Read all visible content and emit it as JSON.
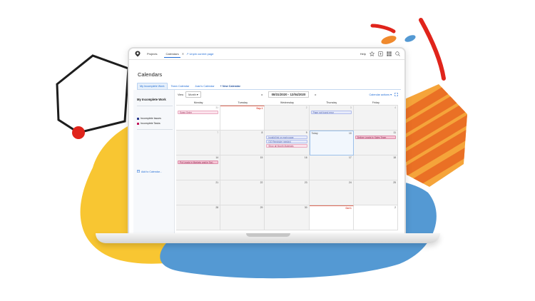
{
  "colors": {
    "accent_blue": "#1e6bd6",
    "deco_yellow": "#f8c632",
    "deco_blue": "#5499d3",
    "deco_orange": "#f08a2d",
    "deco_red": "#e0241b"
  },
  "topbar": {
    "logo_icon": "pin-icon",
    "projects": "Projects",
    "calendars_tab": "Calendars",
    "close_icon": "close-icon",
    "back_link": "↗ Unpin current page",
    "help": "Help",
    "icons": [
      "star-icon",
      "plus-icon",
      "grid-icon",
      "search-icon"
    ]
  },
  "page": {
    "title": "Calendars"
  },
  "tabs": {
    "items": [
      "My Incomplete Work",
      "Team Calendar",
      "Joan's Calendar"
    ],
    "new": "+ New Calendar"
  },
  "sidebar": {
    "title": "My Incomplete Work",
    "items": [
      {
        "label": "Incomplete Issues",
        "color": "#2b3a8c"
      },
      {
        "label": "Incomplete Tasks",
        "color": "#c2185b"
      }
    ],
    "add": "Add to Calendar..."
  },
  "toolbar": {
    "view_label": "View",
    "view_value": "Month ▾",
    "prev": "◂",
    "range": "08/31/2020 - 12/04/2020",
    "next": "▸",
    "calendar_actions": "Calendar actions ▾",
    "fullscreen_icon": "expand-icon"
  },
  "calendar": {
    "days_of_week": [
      "Monday",
      "Tuesday",
      "Wednesday",
      "Thursday",
      "Friday"
    ],
    "weeks": [
      [
        {
          "day": "31",
          "style": "muted",
          "cur": true,
          "events": [
            {
              "text": "Swag Order",
              "style": "pink"
            }
          ]
        },
        {
          "day": "Sep 1",
          "style": "red",
          "cur": false,
          "events": []
        },
        {
          "day": "2",
          "style": "muted",
          "cur": false,
          "events": []
        },
        {
          "day": "3",
          "style": "muted",
          "cur": false,
          "events": [
            {
              "text": "Page not found error",
              "style": "blue"
            }
          ]
        },
        {
          "day": "4",
          "style": "muted",
          "cur": false,
          "events": []
        }
      ],
      [
        {
          "day": "7",
          "style": "muted",
          "cur": false,
          "events": []
        },
        {
          "day": "8",
          "style": "",
          "cur": false,
          "events": []
        },
        {
          "day": "9",
          "style": "",
          "cur": false,
          "events": [
            {
              "text": "Invalid link on main page",
              "style": "blue"
            },
            {
              "text": "QQ Reminder needed",
              "style": "blue"
            },
            {
              "text": "Shop all Month Materials",
              "style": "pink"
            }
          ]
        },
        {
          "day": "10",
          "style": "",
          "cur": false,
          "today": true,
          "events": []
        },
        {
          "day": "11",
          "style": "",
          "cur": false,
          "events": [
            {
              "text": "Deliver Leads to Sales Team",
              "style": "pink-dark"
            }
          ]
        }
      ],
      [
        {
          "day": "14",
          "style": "",
          "cur": false,
          "events": [
            {
              "text": "Put Leads in Marketo and/or Sal...",
              "style": "pink-dark"
            }
          ]
        },
        {
          "day": "15",
          "style": "",
          "cur": false,
          "events": []
        },
        {
          "day": "16",
          "style": "",
          "cur": false,
          "events": []
        },
        {
          "day": "17",
          "style": "",
          "cur": false,
          "events": []
        },
        {
          "day": "18",
          "style": "",
          "cur": false,
          "events": []
        }
      ],
      [
        {
          "day": "21",
          "style": "",
          "cur": false,
          "events": []
        },
        {
          "day": "22",
          "style": "",
          "cur": false,
          "events": []
        },
        {
          "day": "23",
          "style": "",
          "cur": false,
          "events": []
        },
        {
          "day": "24",
          "style": "",
          "cur": false,
          "events": []
        },
        {
          "day": "25",
          "style": "",
          "cur": false,
          "events": []
        }
      ],
      [
        {
          "day": "28",
          "style": "",
          "cur": false,
          "events": []
        },
        {
          "day": "29",
          "style": "",
          "cur": false,
          "events": []
        },
        {
          "day": "30",
          "style": "",
          "cur": false,
          "events": []
        },
        {
          "day": "Oct 1",
          "style": "red",
          "cur": true,
          "events": []
        },
        {
          "day": "2",
          "style": "",
          "cur": true,
          "events": []
        }
      ]
    ]
  }
}
